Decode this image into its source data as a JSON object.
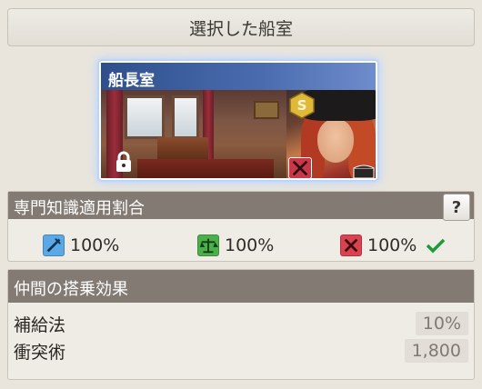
{
  "header": {
    "title": "選択した船室"
  },
  "room_card": {
    "room_name": "船長室",
    "portrait_badge": "S",
    "lock_icon": "lock-icon",
    "class_icon": "crossed-swords-icon",
    "glow_color": "#bcd6ff"
  },
  "expertise": {
    "title": "専門知識適用割合",
    "help_label": "?",
    "rates": [
      {
        "icon": "spyglass-icon",
        "color": "#5aa8e6",
        "value": "100%"
      },
      {
        "icon": "scales-icon",
        "color": "#4caf4c",
        "value": "100%"
      },
      {
        "icon": "crossed-swords-icon",
        "color": "#d9424e",
        "value": "100%"
      }
    ],
    "active_check": "check-icon"
  },
  "crew_effect": {
    "title": "仲間の搭乗効果",
    "rows": [
      {
        "label": "補給法",
        "value": "10%"
      },
      {
        "label": "衝突術",
        "value": "1,800"
      }
    ]
  }
}
